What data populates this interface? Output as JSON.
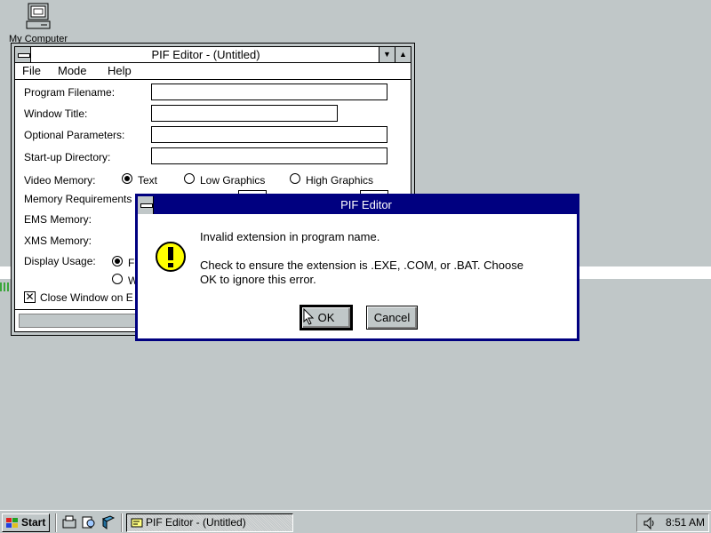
{
  "desktop": {
    "icon_label": "My Computer"
  },
  "pif_window": {
    "title": "PIF Editor - (Untitled)",
    "menu": [
      "File",
      "Mode",
      "Help"
    ],
    "fields": {
      "program_filename": "Program Filename:",
      "window_title": "Window Title:",
      "optional_parameters": "Optional Parameters:",
      "startup_directory": "Start-up Directory:",
      "video_memory": "Video Memory:",
      "memory_requirements": "Memory Requirements",
      "ems_memory": "EMS Memory:",
      "xms_memory": "XMS Memory:",
      "display_usage": "Display Usage:"
    },
    "video_options": [
      "Text",
      "Low Graphics",
      "High Graphics"
    ],
    "video_selected": "Text",
    "display_option_1": "F",
    "display_option_2": "W",
    "close_window_label": "Close Window on E",
    "close_window_checked": true
  },
  "dialog": {
    "title": "PIF Editor",
    "icon": "exclamation-icon",
    "line1": "Invalid extension in program name.",
    "line2": "Check to ensure the extension is .EXE, .COM, or .BAT. Choose",
    "line3": "OK to ignore this error.",
    "ok_label": "OK",
    "cancel_label": "Cancel"
  },
  "taskbar": {
    "start_label": "Start",
    "task_label": "PIF Editor - (Untitled)",
    "clock": "8:51 AM",
    "quick_launch": [
      "explorer-icon",
      "find-icon",
      "document-icon"
    ]
  },
  "colors": {
    "desktop": "#c0c7c8",
    "title_active": "#000080",
    "warning_yellow": "#ffff00"
  }
}
